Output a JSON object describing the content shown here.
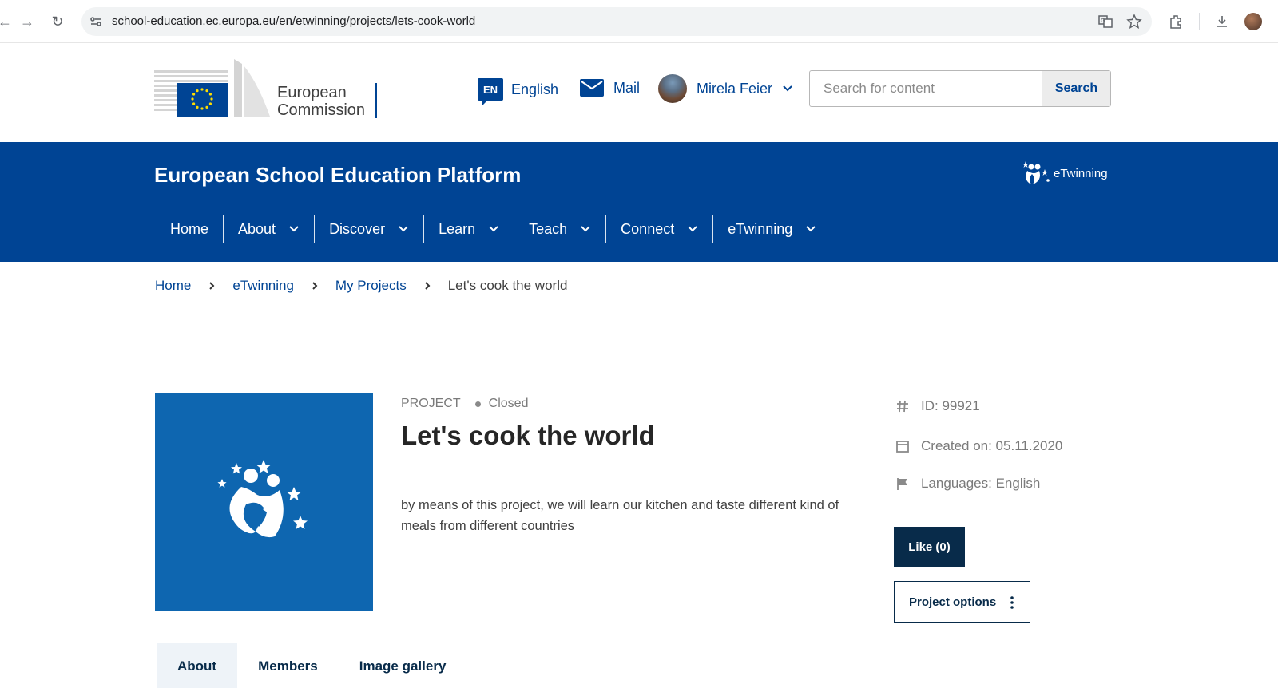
{
  "browser": {
    "url": "school-education.ec.europa.eu/en/etwinning/projects/lets-cook-world"
  },
  "header": {
    "ec_logo_line1": "European",
    "ec_logo_line2": "Commission",
    "language_code": "EN",
    "language_label": "English",
    "mail_label": "Mail",
    "user_name": "Mirela Feier",
    "search_placeholder": "Search for content",
    "search_button": "Search"
  },
  "band": {
    "site_title": "European School Education Platform",
    "etwinning_logo": "eTwinning",
    "menu": [
      {
        "label": "Home",
        "has_dropdown": false
      },
      {
        "label": "About",
        "has_dropdown": true
      },
      {
        "label": "Discover",
        "has_dropdown": true
      },
      {
        "label": "Learn",
        "has_dropdown": true
      },
      {
        "label": "Teach",
        "has_dropdown": true
      },
      {
        "label": "Connect",
        "has_dropdown": true
      },
      {
        "label": "eTwinning",
        "has_dropdown": true
      }
    ]
  },
  "breadcrumb": [
    "Home",
    "eTwinning",
    "My Projects",
    "Let's cook the world"
  ],
  "project": {
    "kicker": "PROJECT",
    "status": "Closed",
    "title": "Let's cook the world",
    "description": "by means of this project, we will learn our kitchen and taste different kind of meals from different countries",
    "id_label": "ID: 99921",
    "created_label": "Created on: 05.11.2020",
    "languages_label": "Languages: English",
    "like_button": "Like (0)",
    "options_button": "Project options"
  },
  "tabs": [
    {
      "label": "About",
      "active": true
    },
    {
      "label": "Members",
      "active": false
    },
    {
      "label": "Image gallery",
      "active": false
    }
  ],
  "colors": {
    "brand_blue": "#004494",
    "dark_button": "#082b4a",
    "project_tile": "#0e66b0"
  }
}
